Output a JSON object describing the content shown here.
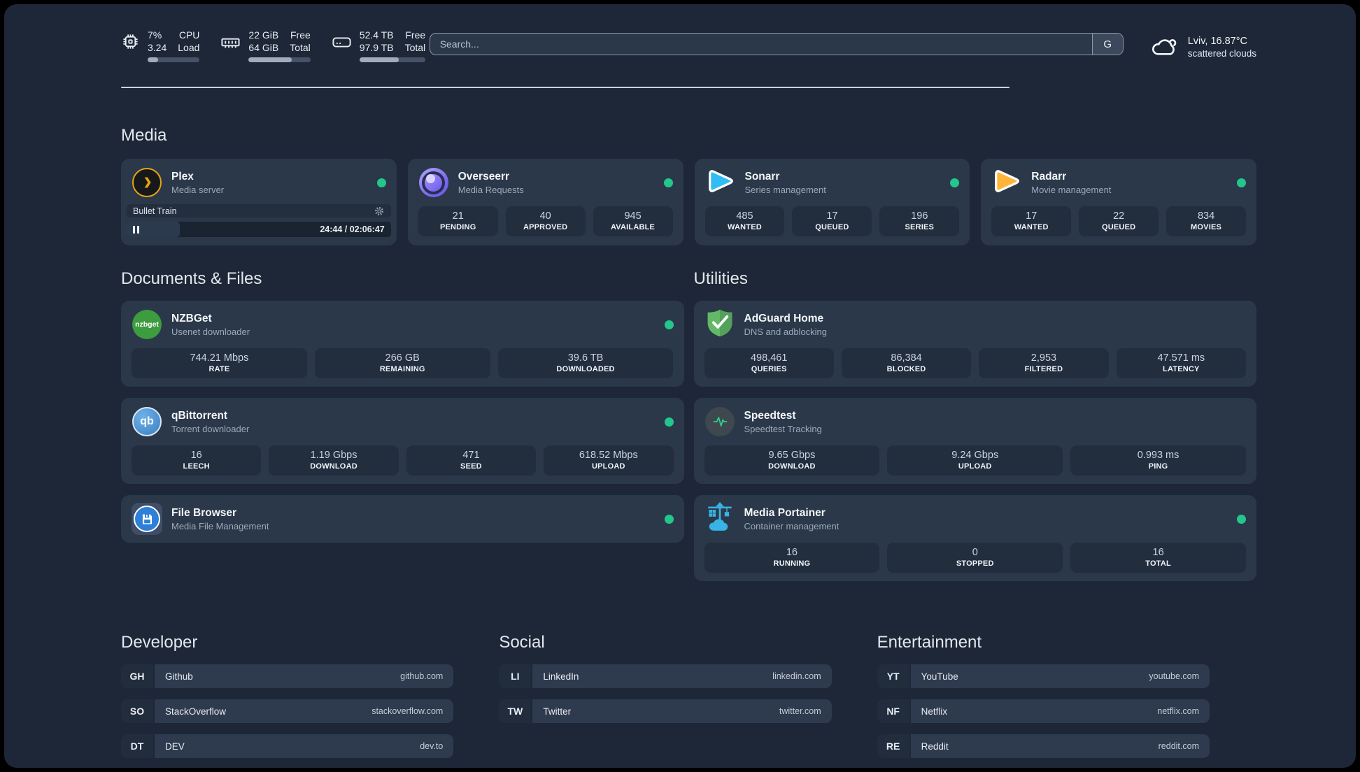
{
  "header": {
    "resources": [
      {
        "icon": "cpu-icon",
        "values": [
          "7%",
          "3.24"
        ],
        "labels": [
          "CPU",
          "Load"
        ],
        "progress_pct": 20
      },
      {
        "icon": "memory-icon",
        "values": [
          "22 GiB",
          "64 GiB"
        ],
        "labels": [
          "Free",
          "Total"
        ],
        "progress_pct": 70
      },
      {
        "icon": "disk-icon",
        "values": [
          "52.4 TB",
          "97.9 TB"
        ],
        "labels": [
          "Free",
          "Total"
        ],
        "progress_pct": 60
      }
    ],
    "search": {
      "placeholder": "Search...",
      "provider_button_label": "G"
    },
    "weather": {
      "location_temperature": "Lviv, 16.87°C",
      "condition": "scattered clouds"
    }
  },
  "sections": {
    "media": {
      "title": "Media",
      "cards": [
        {
          "name": "Plex",
          "description": "Media server",
          "online": true,
          "player": {
            "title": "Bullet Train",
            "time": "24:44 / 02:06:47",
            "progress_pct": 20
          }
        },
        {
          "name": "Overseerr",
          "description": "Media Requests",
          "online": true,
          "stats": [
            {
              "value": "21",
              "label": "PENDING"
            },
            {
              "value": "40",
              "label": "APPROVED"
            },
            {
              "value": "945",
              "label": "AVAILABLE"
            }
          ]
        },
        {
          "name": "Sonarr",
          "description": "Series management",
          "online": true,
          "stats": [
            {
              "value": "485",
              "label": "WANTED"
            },
            {
              "value": "17",
              "label": "QUEUED"
            },
            {
              "value": "196",
              "label": "SERIES"
            }
          ]
        },
        {
          "name": "Radarr",
          "description": "Movie management",
          "online": true,
          "stats": [
            {
              "value": "17",
              "label": "WANTED"
            },
            {
              "value": "22",
              "label": "QUEUED"
            },
            {
              "value": "834",
              "label": "MOVIES"
            }
          ]
        }
      ]
    },
    "documents": {
      "title": "Documents & Files",
      "cards": [
        {
          "name": "NZBGet",
          "description": "Usenet downloader",
          "online": true,
          "icon_text": "nzbget",
          "stats": [
            {
              "value": "744.21 Mbps",
              "label": "RATE"
            },
            {
              "value": "266 GB",
              "label": "REMAINING"
            },
            {
              "value": "39.6 TB",
              "label": "DOWNLOADED"
            }
          ]
        },
        {
          "name": "qBittorrent",
          "description": "Torrent downloader",
          "online": true,
          "icon_text": "qb",
          "stats": [
            {
              "value": "16",
              "label": "LEECH"
            },
            {
              "value": "1.19 Gbps",
              "label": "DOWNLOAD"
            },
            {
              "value": "471",
              "label": "SEED"
            },
            {
              "value": "618.52 Mbps",
              "label": "UPLOAD"
            }
          ]
        },
        {
          "name": "File Browser",
          "description": "Media File Management",
          "online": true
        }
      ]
    },
    "utilities": {
      "title": "Utilities",
      "cards": [
        {
          "name": "AdGuard Home",
          "description": "DNS and adblocking",
          "stats": [
            {
              "value": "498,461",
              "label": "QUERIES"
            },
            {
              "value": "86,384",
              "label": "BLOCKED"
            },
            {
              "value": "2,953",
              "label": "FILTERED"
            },
            {
              "value": "47.571 ms",
              "label": "LATENCY"
            }
          ]
        },
        {
          "name": "Speedtest",
          "description": "Speedtest Tracking",
          "stats": [
            {
              "value": "9.65 Gbps",
              "label": "DOWNLOAD"
            },
            {
              "value": "9.24 Gbps",
              "label": "UPLOAD"
            },
            {
              "value": "0.993 ms",
              "label": "PING"
            }
          ]
        },
        {
          "name": "Media Portainer",
          "description": "Container management",
          "online": true,
          "stats": [
            {
              "value": "16",
              "label": "RUNNING"
            },
            {
              "value": "0",
              "label": "STOPPED"
            },
            {
              "value": "16",
              "label": "TOTAL"
            }
          ]
        }
      ]
    },
    "bookmarks": [
      {
        "title": "Developer",
        "items": [
          {
            "abbr": "GH",
            "name": "Github",
            "domain": "github.com"
          },
          {
            "abbr": "SO",
            "name": "StackOverflow",
            "domain": "stackoverflow.com"
          },
          {
            "abbr": "DT",
            "name": "DEV",
            "domain": "dev.to"
          }
        ]
      },
      {
        "title": "Social",
        "items": [
          {
            "abbr": "LI",
            "name": "LinkedIn",
            "domain": "linkedin.com"
          },
          {
            "abbr": "TW",
            "name": "Twitter",
            "domain": "twitter.com"
          }
        ]
      },
      {
        "title": "Entertainment",
        "items": [
          {
            "abbr": "YT",
            "name": "YouTube",
            "domain": "youtube.com"
          },
          {
            "abbr": "NF",
            "name": "Netflix",
            "domain": "netflix.com"
          },
          {
            "abbr": "RE",
            "name": "Reddit",
            "domain": "reddit.com"
          }
        ]
      }
    ]
  },
  "colors": {
    "status_online": "#23c78b",
    "plex_accent": "#e6a312",
    "sonarr_accent": "#30bdf6",
    "radarr_accent": "#ffb53a",
    "nzbget_accent": "#3d9c40",
    "qbittorrent_accent": "#4d94d4",
    "adguard_accent": "#63b967",
    "speedtest_pulse": "#2fd08c",
    "portainer_accent": "#38b3e6",
    "filebrowser_accent": "#2d7fd8"
  }
}
